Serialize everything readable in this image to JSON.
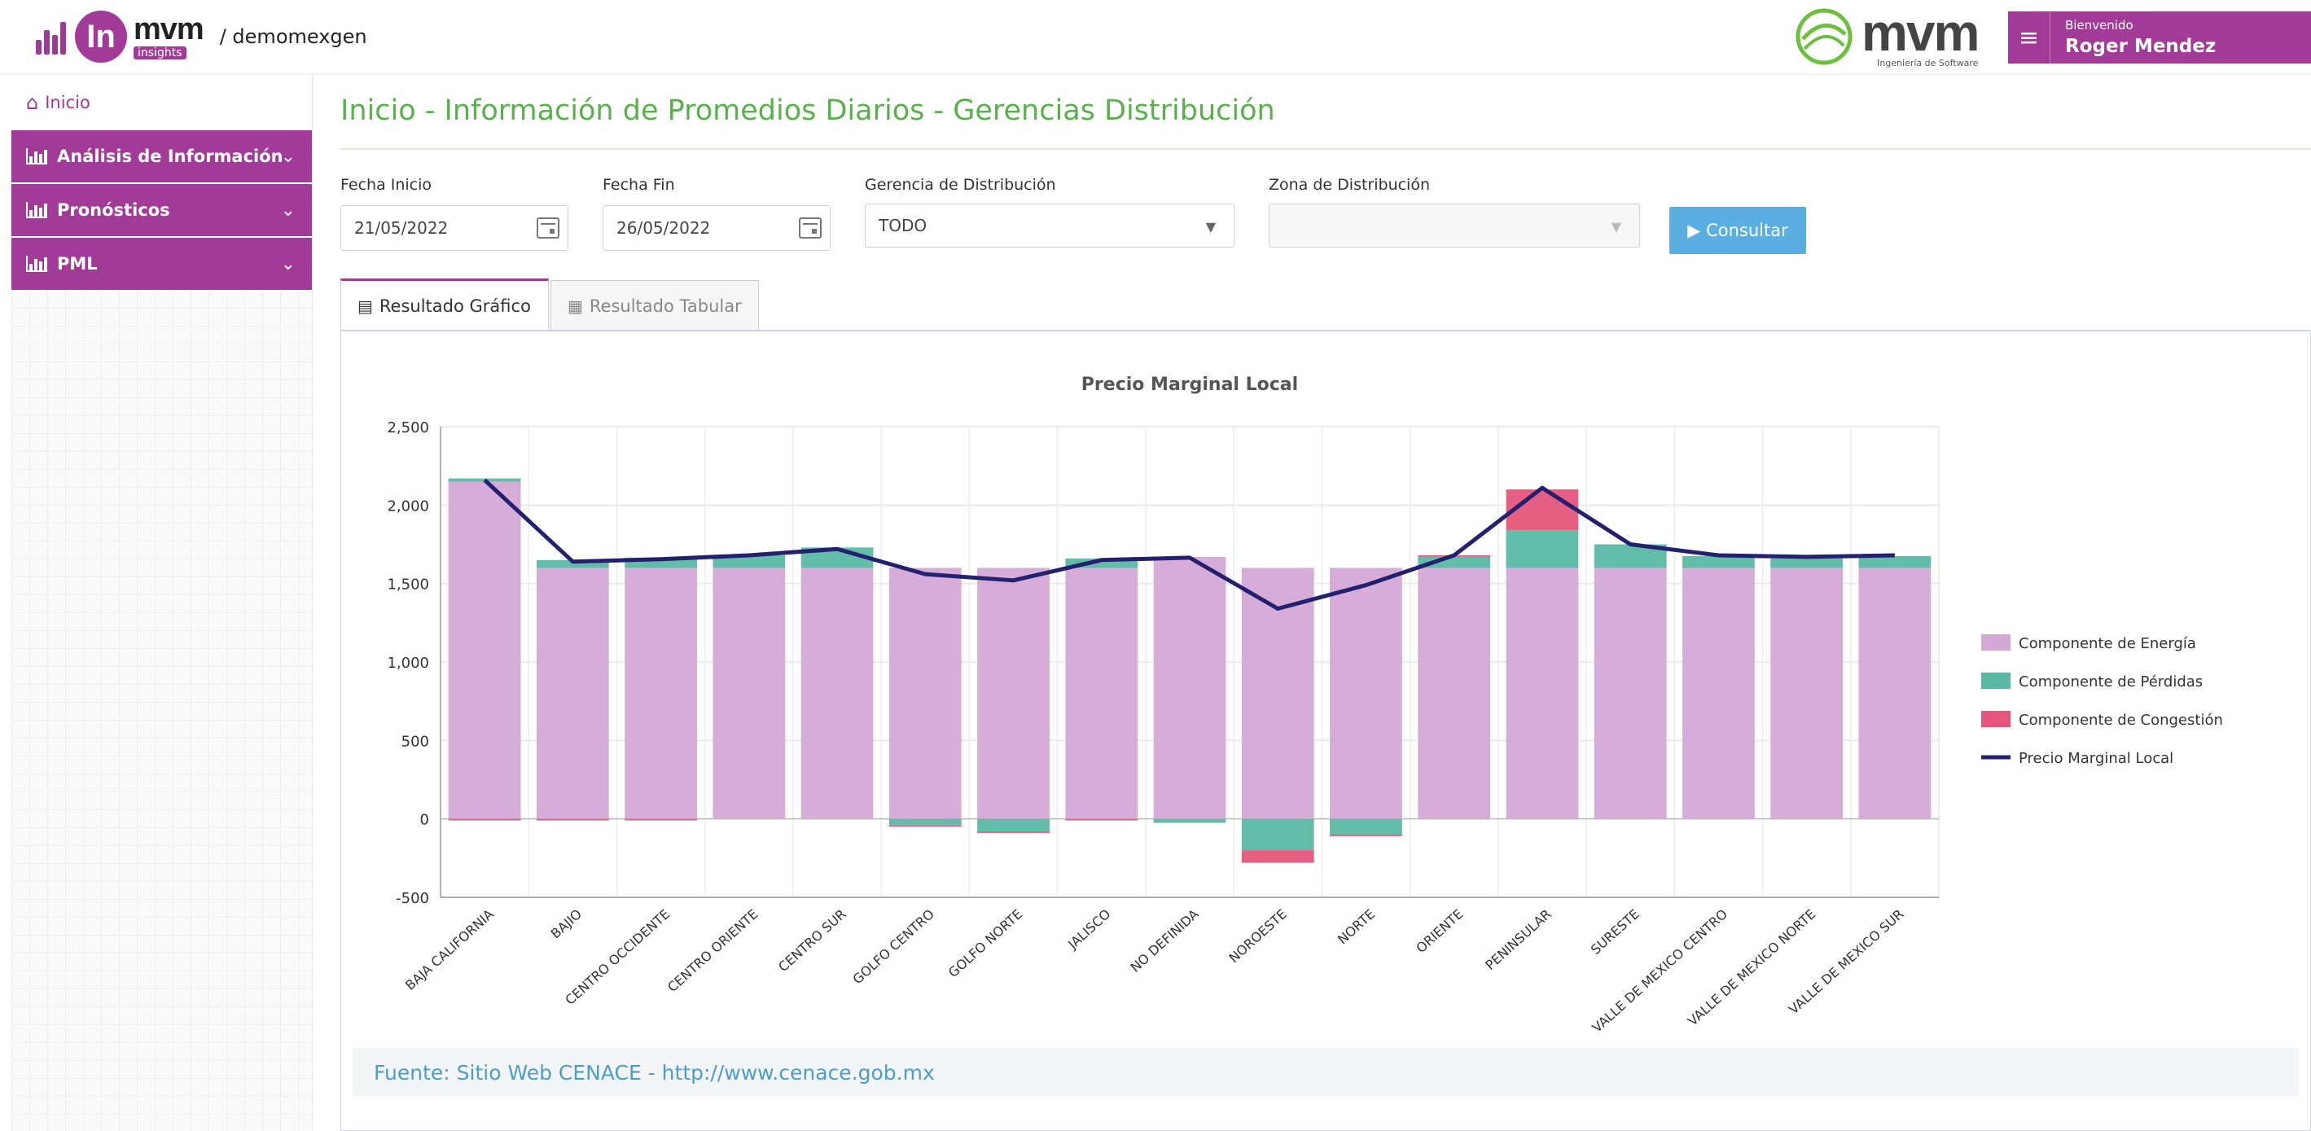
{
  "header": {
    "app_name": "mvm",
    "app_sub": "insights",
    "logo_letters": "In",
    "env": "/ demomexgen",
    "brand_name": "mvm",
    "brand_sub": "Ingeniería de Software",
    "welcome": "Bienvenido",
    "username": "Roger Mendez",
    "menu_icon": "≡"
  },
  "sidebar": {
    "home": "Inicio",
    "items": [
      {
        "label": "Análisis de Información"
      },
      {
        "label": "Pronósticos"
      },
      {
        "label": "PML"
      }
    ]
  },
  "main": {
    "title": "Inicio - Información de Promedios Diarios - Gerencias Distribución",
    "filters": {
      "fecha_inicio_label": "Fecha Inicio",
      "fecha_inicio_value": "21/05/2022",
      "fecha_fin_label": "Fecha Fin",
      "fecha_fin_value": "26/05/2022",
      "gerencia_label": "Gerencia de Distribución",
      "gerencia_value": "TODO",
      "zona_label": "Zona de Distribución",
      "zona_value": ""
    },
    "consultar_label": "▶ Consultar",
    "tabs": [
      {
        "label": "Resultado Gráfico",
        "active": true
      },
      {
        "label": "Resultado Tabular",
        "active": false
      }
    ],
    "fuente": "Fuente: Sitio Web CENACE - http://www.cenace.gob.mx"
  },
  "chart_data": {
    "type": "bar",
    "stacked": true,
    "title": "Precio Marginal Local",
    "ylim": [
      -500,
      2500
    ],
    "yticks": [
      "2,500",
      "2,000",
      "1,500",
      "1,000",
      "500",
      "0",
      "-500"
    ],
    "ytick_values": [
      2500,
      2000,
      1500,
      1000,
      500,
      0,
      -500
    ],
    "legend_position": "right",
    "grid": true,
    "categories": [
      "BAJA CALIFORNIA",
      "BAJIO",
      "CENTRO OCCIDENTE",
      "CENTRO ORIENTE",
      "CENTRO SUR",
      "GOLFO CENTRO",
      "GOLFO NORTE",
      "JALISCO",
      "NO DEFINIDA",
      "NOROESTE",
      "NORTE",
      "ORIENTE",
      "PENINSULAR",
      "SURESTE",
      "VALLE DE MEXICO CENTRO",
      "VALLE DE MEXICO NORTE",
      "VALLE DE MEXICO SUR"
    ],
    "series": [
      {
        "name": "Componente de Energía",
        "color": "#d4a9d6",
        "values": [
          2150,
          1600,
          1600,
          1600,
          1600,
          1600,
          1600,
          1600,
          1670,
          1600,
          1600,
          1600,
          1600,
          1600,
          1600,
          1600,
          1600
        ]
      },
      {
        "name": "Componente de Pérdidas",
        "color": "#5bb8a2",
        "values": [
          20,
          50,
          65,
          80,
          130,
          -40,
          -80,
          60,
          -25,
          -200,
          -100,
          70,
          240,
          150,
          75,
          60,
          75
        ]
      },
      {
        "name": "Componente de Congestión",
        "color": "#e4567c",
        "values": [
          -10,
          -10,
          -10,
          0,
          0,
          -10,
          -10,
          -10,
          0,
          -80,
          -10,
          10,
          260,
          0,
          0,
          0,
          0
        ]
      }
    ],
    "line": {
      "name": "Precio Marginal Local",
      "color": "#23206e",
      "values": [
        2160,
        1640,
        1655,
        1680,
        1720,
        1560,
        1520,
        1650,
        1665,
        1340,
        1490,
        1680,
        2110,
        1750,
        1680,
        1670,
        1680
      ]
    }
  }
}
